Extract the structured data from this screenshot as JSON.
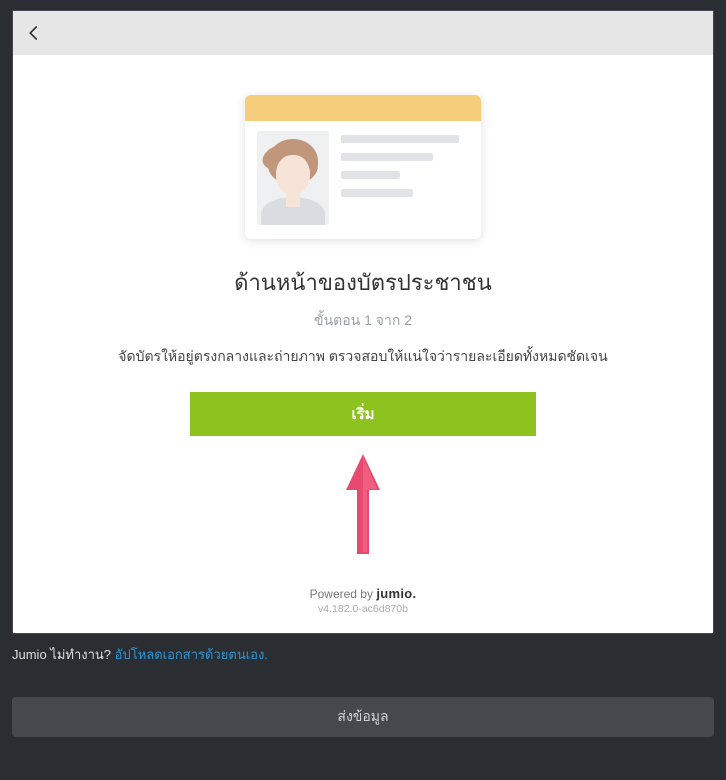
{
  "card": {
    "title": "ด้านหน้าของบัตรประชาชน",
    "step_text": "ขั้นตอน 1 จาก 2",
    "description": "จัดบัตรให้อยู่ตรงกลางและถ่ายภาพ ตรวจสอบให้แน่ใจว่ารายละเอียดทั้งหมดชัดเจน",
    "start_label": "เริ่ม",
    "powered_by_prefix": "Powered by ",
    "powered_by_brand": "jumio.",
    "version": "v4.182.0-ac6d870b"
  },
  "below": {
    "prompt": "Jumio ไม่ทำงาน? ",
    "link_text": "อัปโหลดเอกสารด้วยตนเอง."
  },
  "submit": {
    "label": "ส่งข้อมูล"
  },
  "colors": {
    "primary_button": "#8dc21f",
    "arrow": "#e84a6f"
  }
}
